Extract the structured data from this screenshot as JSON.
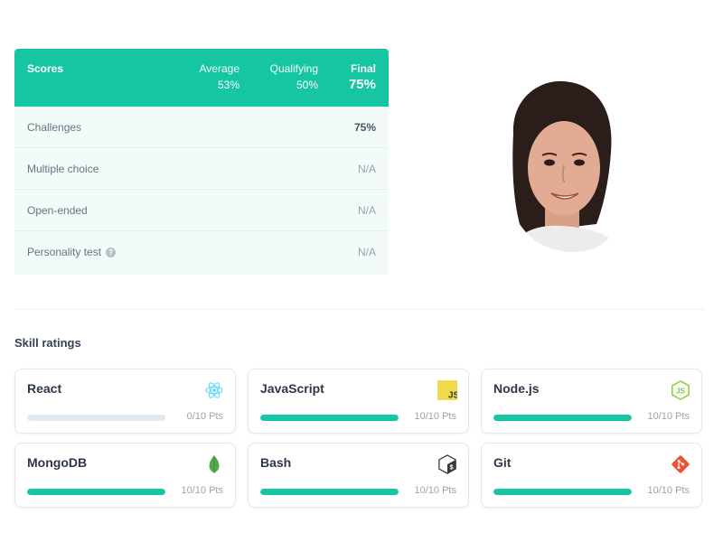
{
  "scores": {
    "title": "Scores",
    "average_label": "Average",
    "average_value": "53%",
    "qualifying_label": "Qualifying",
    "qualifying_value": "50%",
    "final_label": "Final",
    "final_value": "75%",
    "rows": [
      {
        "label": "Challenges",
        "value": "75%"
      },
      {
        "label": "Multiple choice",
        "value": "N/A"
      },
      {
        "label": "Open-ended",
        "value": "N/A"
      },
      {
        "label": "Personality test",
        "value": "N/A",
        "help_icon": "?"
      }
    ]
  },
  "colors": {
    "accent": "#16c6a3",
    "bar_empty": "#e2e8f5"
  },
  "skills": {
    "title": "Skill ratings",
    "items": [
      {
        "name": "React",
        "points": "0/10 Pts",
        "progress": 0,
        "icon": "react-icon"
      },
      {
        "name": "JavaScript",
        "points": "10/10 Pts",
        "progress": 1,
        "icon": "javascript-icon",
        "icon_text": "JS"
      },
      {
        "name": "Node.js",
        "points": "10/10 Pts",
        "progress": 1,
        "icon": "nodejs-icon",
        "icon_text": "JS"
      },
      {
        "name": "MongoDB",
        "points": "10/10 Pts",
        "progress": 1,
        "icon": "mongodb-icon"
      },
      {
        "name": "Bash",
        "points": "10/10 Pts",
        "progress": 1,
        "icon": "bash-icon",
        "icon_text": "$"
      },
      {
        "name": "Git",
        "points": "10/10 Pts",
        "progress": 1,
        "icon": "git-icon"
      }
    ]
  }
}
